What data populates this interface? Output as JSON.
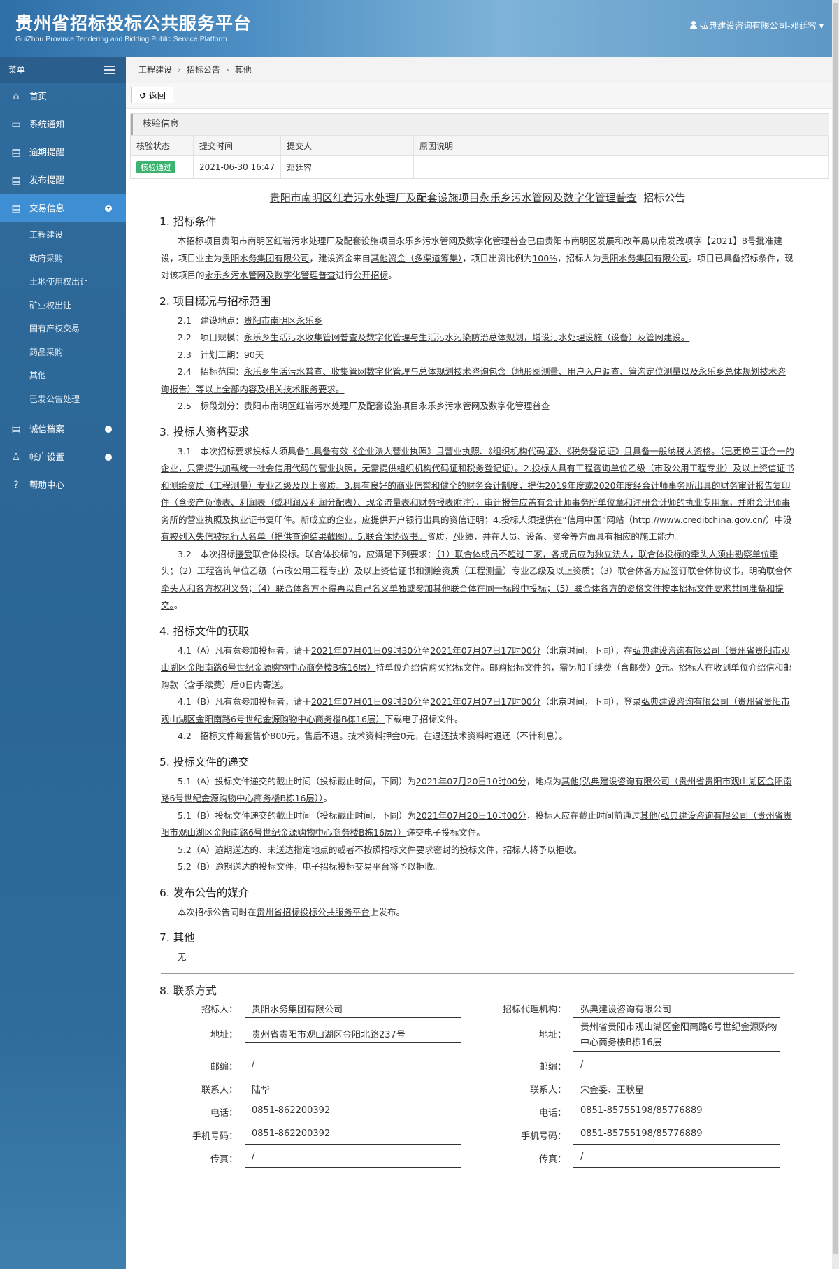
{
  "header": {
    "title": "贵州省招标投标公共服务平台",
    "subtitle": "GuiZhou Province Tendering and Bidding Public Service Platform",
    "user": "弘典建设咨询有限公司-邓廷容"
  },
  "sidebar": {
    "menu_label": "菜单",
    "items": [
      {
        "label": "首页",
        "icon": "home-icon"
      },
      {
        "label": "系统通知",
        "icon": "monitor-icon"
      },
      {
        "label": "逾期提醒",
        "icon": "calendar-icon"
      },
      {
        "label": "发布提醒",
        "icon": "calendar-icon"
      },
      {
        "label": "交易信息",
        "icon": "calendar-icon"
      },
      {
        "label": "诚信档案",
        "icon": "calendar-icon"
      },
      {
        "label": "帐户设置",
        "icon": "user-icon"
      },
      {
        "label": "帮助中心",
        "icon": "help-icon"
      }
    ],
    "sub_items": [
      "工程建设",
      "政府采购",
      "土地使用权出让",
      "矿业权出让",
      "国有产权交易",
      "药品采购",
      "其他",
      "已发公告处理"
    ]
  },
  "breadcrumb": [
    "工程建设",
    "招标公告",
    "其他"
  ],
  "back_label": "返回",
  "verify": {
    "title": "核验信息",
    "headers": [
      "核验状态",
      "提交时间",
      "提交人",
      "原因说明"
    ],
    "status": "核验通过",
    "time": "2021-06-30 16:47",
    "submitter": "邓廷容",
    "reason": ""
  },
  "notice": {
    "project": "贵阳市南明区红岩污水处理厂及配套设施项目永乐乡污水管网及数字化管理普查",
    "title_suffix": "招标公告",
    "s1": {
      "h": "1. 招标条件",
      "t1": "本招标项目",
      "v1": "贵阳市南明区红岩污水处理厂及配套设施项目永乐乡污水管网及数字化管理普查",
      "t2": "已由",
      "v2": "贵阳市南明区发展和改革局",
      "t3": "以",
      "v3": "南发改项字【2021】8号",
      "t4": "批准建设，项目业主为",
      "v4": "贵阳水务集团有限公司",
      "t5": "，建设资金来自",
      "v5": "其他资金（多渠道筹集）",
      "t6": "，项目出资比例为",
      "v6": "100%",
      "t7": "，招标人为",
      "v7": "贵阳水务集团有限公司",
      "t8": "。项目已具备招标条件，现对该项目的",
      "v8": "永乐乡污水管网及数字化管理普查",
      "t9": "进行",
      "v9": "公开招标",
      "t10": "。"
    },
    "s2": {
      "h": "2. 项目概况与招标范围",
      "l1": "2.1　建设地点：",
      "v1": "贵阳市南明区永乐乡",
      "l2": "2.2　项目规模：",
      "v2": "永乐乡生活污水收集管网普查及数字化管理与生活污水污染防治总体规划，增设污水处理设施（设备）及管网建设。",
      "l3": "2.3　计划工期：",
      "v3": "90",
      "t3": "天",
      "l4": "2.4　招标范围：",
      "v4": "永乐乡生活污水普查、收集管网数字化管理与总体规划技术咨询包含（地形图测量、用户入户调查、管沟定位测量以及永乐乡总体规划技术咨询报告）等以上全部内容及相关技术服务要求。",
      "l5": "2.5　标段划分：",
      "v5": "贵阳市南明区红岩污水处理厂及配套设施项目永乐乡污水管网及数字化管理普查"
    },
    "s3": {
      "h": "3. 投标人资格要求",
      "l1": "3.1　本次招标要求投标人须具备",
      "v1": "1.具备有效《企业法人营业执照》且营业执照、《组织机构代码证》、《税务登记证》且具备一般纳税人资格。（已更换三证合一的企业，只需提供加载统一社会信用代码的营业执照，无需提供组织机构代码证和税务登记证）。2.投标人具有工程咨询单位乙级（市政公用工程专业）及以上资信证书和测绘资质（工程测量）专业乙级及以上资质。3.具有良好的商业信誉和健全的财务会计制度，提供2019年度或2020年度经会计师事务所出具的财务审计报告复印件（含资产负债表、利润表（或利润及利润分配表）、现金流量表和财务报表附注），审计报告应盖有会计师事务所单位章和注册会计师的执业专用章，并附会计师事务所的营业执照及执业证书复印件。新成立的企业，应提供开户银行出具的资信证明；4.投标人须提供在“信用中国”网站（http://www.creditchina.gov.cn/）中没有被列入失信被执行人名单（提供查询结果截图）。5.联合体协议书。",
      "t1": "资质，",
      "v1b": "/",
      "t1b": "业绩，并在人员、设备、资金等方面具有相应的施工能力。",
      "l2": "3.2　本次招标",
      "v2": "接受",
      "t2": "联合体投标。联合体投标的，应满足下列要求：",
      "v2b": "（1）联合体成员不超过二家，各成员应为独立法人，联合体投标的牵头人须由勘察单位牵头；（2）工程咨询单位乙级（市政公用工程专业）及以上资信证书和测绘资质（工程测量）专业乙级及以上资质；（3）联合体各方应签订联合体协议书，明确联合体牵头人和各方权利义务；（4）联合体各方不得再以自己名义单独或参加其他联合体在同一标段中投标；（5）联合体各方的资格文件按本招标文件要求共同准备和提交。",
      "t2b": "。"
    },
    "s4": {
      "h": "4. 招标文件的获取",
      "a1": "4.1（A）凡有意参加投标者，请于",
      "a_start": "2021年07月01日09时30分",
      "a2": "至",
      "a_end": "2021年07月07日17时00分",
      "a3": "（北京时间，下同），在",
      "a_place": "弘典建设咨询有限公司（贵州省贵阳市观山湖区金阳南路6号世纪金源购物中心商务楼B栋16层）",
      "a4": "持单位介绍信购买招标文件。邮购招标文件的，需另加手续费（含邮费）",
      "a_fee": "0",
      "a5": "元。招标人在收到单位介绍信和邮购款（含手续费）后",
      "a_days": "0",
      "a6": "日内寄送。",
      "b1": "4.1（B）凡有意参加投标者，请于",
      "b_start": "2021年07月01日09时30分",
      "b2": "至",
      "b_end": "2021年07月07日17时00分",
      "b3": "（北京时间，下同），登录",
      "b_place": "弘典建设咨询有限公司（贵州省贵阳市观山湖区金阳南路6号世纪金源购物中心商务楼B栋16层）",
      "b4": "下载电子招标文件。",
      "c1": "4.2　招标文件每套售价",
      "c_price": "800",
      "c2": "元，售后不退。技术资料押金",
      "c_dep": "0",
      "c3": "元，在退还技术资料时退还（不计利息）。"
    },
    "s5": {
      "h": "5. 投标文件的递交",
      "a1": "5.1（A）投标文件递交的截止时间（投标截止时间，下同）为",
      "a_time": "2021年07月20日10时00分",
      "a2": "，地点为",
      "a_place": "其他(弘典建设咨询有限公司（贵州省贵阳市观山湖区金阳南路6号世纪金源购物中心商务楼B栋16层））",
      "a3": "。",
      "b1": "5.1（B）投标文件递交的截止时间（投标截止时间，下同）为",
      "b_time": "2021年07月20日10时00分",
      "b2": "，投标人应在截止时间前通过",
      "b_place": "其他(弘典建设咨询有限公司（贵州省贵阳市观山湖区金阳南路6号世纪金源购物中心商务楼B栋16层））",
      "b3": "递交电子投标文件。",
      "c": "5.2（A）逾期送达的、未送达指定地点的或者不按照招标文件要求密封的投标文件，招标人将予以拒收。",
      "d": "5.2（B）逾期送达的投标文件，电子招标投标交易平台将予以拒收。"
    },
    "s6": {
      "h": "6. 发布公告的媒介",
      "t1": "本次招标公告同时在",
      "v1": "贵州省招标投标公共服务平台",
      "t2": "上发布。"
    },
    "s7": {
      "h": "7. 其他",
      "t": "无"
    },
    "s8": {
      "h": "8. 联系方式",
      "left": {
        "l_name": "招标人：",
        "name": "贵阳水务集团有限公司",
        "l_addr": "地址：",
        "addr": "贵州省贵阳市观山湖区金阳北路237号",
        "l_zip": "邮编：",
        "zip": "/",
        "l_contact": "联系人：",
        "contact": "陆华",
        "l_tel": "电话：",
        "tel": "0851-862200392",
        "l_mobile": "手机号码：",
        "mobile": "0851-862200392",
        "l_fax": "传真：",
        "fax": "/"
      },
      "right": {
        "l_name": "招标代理机构：",
        "name": "弘典建设咨询有限公司",
        "l_addr": "地址：",
        "addr": "贵州省贵阳市观山湖区金阳南路6号世纪金源购物中心商务楼B栋16层",
        "l_zip": "邮编：",
        "zip": "/",
        "l_contact": "联系人：",
        "contact": "宋金委、王秋星",
        "l_tel": "电话：",
        "tel": "0851-85755198/85776889",
        "l_mobile": "手机号码：",
        "mobile": "0851-85755198/85776889",
        "l_fax": "传真：",
        "fax": "/"
      }
    }
  }
}
